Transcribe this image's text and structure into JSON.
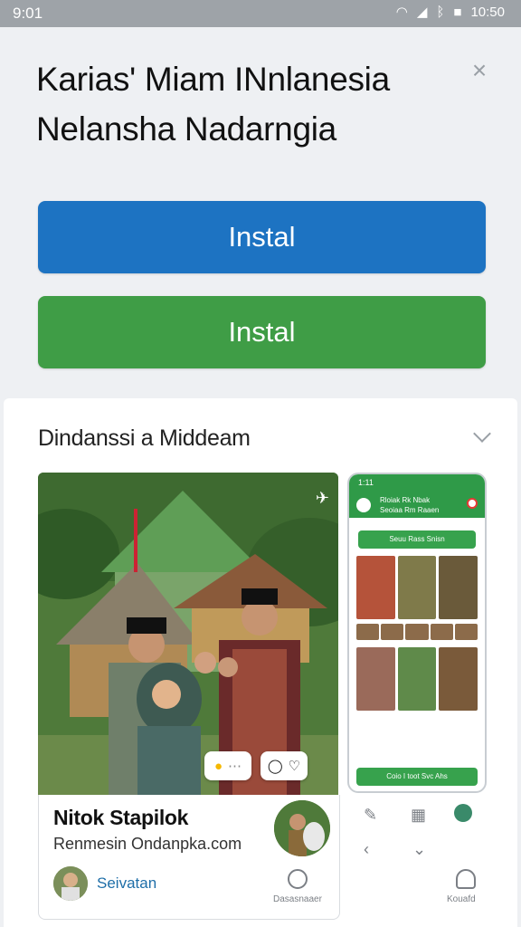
{
  "status_bar": {
    "time_left": "9:01",
    "time_right": "10:50"
  },
  "dialog": {
    "title_line1": "Karias' Miam INnlanesia",
    "title_line2": "Nelansha Nadarngia",
    "buttons": {
      "primary_label": "Instal",
      "secondary_label": "Instal"
    },
    "colors": {
      "primary": "#1d73c2",
      "secondary": "#3f9d46"
    }
  },
  "section": {
    "heading": "Dindanssi a Middeam",
    "card": {
      "title": "Nitok Stapilok",
      "subtitle": "Renmesin Ondanpka.com",
      "footer_label": "Seivatan"
    },
    "phone_preview": {
      "time": "1:11",
      "header_line1": "Rloiak Rk Nbak",
      "header_line2": "Seoiaa Rm Raaen",
      "pill_top": "Seuu Rass Snisn",
      "pill_bottom": "Coio I toot Svc Ahs"
    },
    "bottom_nav": {
      "item1_label": "Dasasnaaer",
      "item2_label": "Kouafd"
    }
  }
}
